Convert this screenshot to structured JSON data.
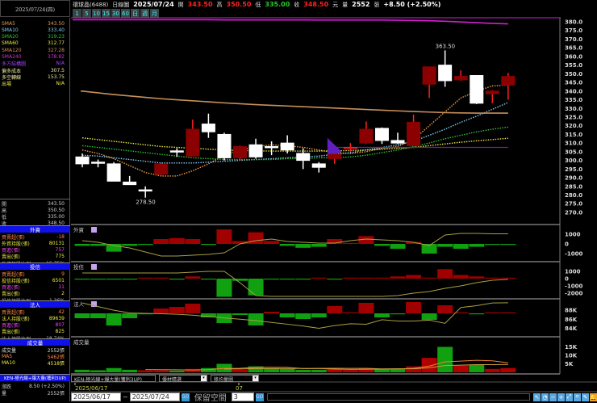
{
  "header": {
    "date_box": "2025/07/24(四)",
    "stock": "環球晶(6488)",
    "chart_type": "日線圖",
    "date": "2025/07/24",
    "open_label": "開",
    "open": "343.50",
    "high_label": "高",
    "high": "350.50",
    "low_label": "低",
    "low": "335.00",
    "close_label": "收",
    "close": "348.50",
    "unit": "元",
    "vol_label": "量",
    "volume": "2552",
    "vol_unit": "張",
    "change": "+8.50 (+2.50%)"
  },
  "periods": [
    "1",
    "5",
    "10",
    "15",
    "30",
    "60",
    "日",
    "週",
    "月"
  ],
  "indicators": [
    {
      "label": "SMA5",
      "value": "343.50",
      "color": "#e0a050",
      "mark": "#2c2"
    },
    {
      "label": "SMA10",
      "value": "333.40",
      "color": "#80c8f0",
      "mark": "#e22"
    },
    {
      "label": "SMA20",
      "value": "319.23",
      "color": "#30c030",
      "mark": "#e22"
    },
    {
      "label": "SMA60",
      "value": "312.77",
      "color": "#e8e840",
      "mark": "#e22"
    },
    {
      "label": "SMA120",
      "value": "327.28",
      "color": "#c8905a",
      "mark": "#e22"
    },
    {
      "label": "SMA240",
      "value": "378.82",
      "color": "#d030d0",
      "mark": "#2c2"
    },
    {
      "label": "多方結構圖",
      "value": "N/A",
      "color": "#a040ff",
      "mark": ""
    },
    {
      "label": "偏多成本",
      "value": "307.5",
      "color": "#e8e8a0",
      "mark": ""
    },
    {
      "label": "多空轉線",
      "value": "153.75",
      "color": "#e8e8a0",
      "mark": ""
    },
    {
      "label": "出場",
      "value": "N/A",
      "color": "#e8e840",
      "mark": ""
    }
  ],
  "ohlc": [
    {
      "label": "開",
      "value": "343.50"
    },
    {
      "label": "高",
      "value": "350.50"
    },
    {
      "label": "低",
      "value": "335.00"
    },
    {
      "label": "收",
      "value": "348.50"
    }
  ],
  "sections": [
    {
      "title": "外資",
      "rows": [
        {
          "label": "買賣超(張)",
          "value": "-18",
          "color": "#f84",
          "mark": "#2c2"
        },
        {
          "label": "外資持股(張)",
          "value": "80131",
          "color": "#ee4",
          "mark": "#2c2"
        },
        {
          "label": "買進(張)",
          "value": "757",
          "color": "#e4e",
          "mark": "#e22"
        },
        {
          "label": "賣出(張)",
          "value": "775",
          "color": "#ee4",
          "mark": "#e22"
        },
        {
          "label": "外資持股比例",
          "value": "16.75%",
          "color": "#bbb",
          "mark": "#2c2"
        }
      ]
    },
    {
      "title": "投信",
      "rows": [
        {
          "label": "買賣超(張)",
          "value": "9",
          "color": "#f84",
          "mark": "#e22"
        },
        {
          "label": "投信持股(張)",
          "value": "6501",
          "color": "#ee4",
          "mark": "#2c2"
        },
        {
          "label": "買進(張)",
          "value": "11",
          "color": "#e4e",
          "mark": "#e22"
        },
        {
          "label": "賣出(張)",
          "value": "2",
          "color": "#ee4",
          "mark": "#e22"
        },
        {
          "label": "投信持股比例",
          "value": "1.36%",
          "color": "#bbb",
          "mark": "#bbb"
        }
      ]
    },
    {
      "title": "法人",
      "rows": [
        {
          "label": "買賣超(張)",
          "value": "42",
          "color": "#f84",
          "mark": "#2c2"
        },
        {
          "label": "法人持股(張)",
          "value": "89639",
          "color": "#ee4",
          "mark": "#e22"
        },
        {
          "label": "買進(張)",
          "value": "807",
          "color": "#e4e",
          "mark": "#e22"
        },
        {
          "label": "賣出(張)",
          "value": "825",
          "color": "#ee4",
          "mark": "#e22"
        },
        {
          "label": "法人持股比例",
          "value": "18.74%",
          "color": "#bbb",
          "mark": "#bbb"
        }
      ]
    },
    {
      "title": "成交量",
      "rows": [
        {
          "label": "成交量",
          "value": "2552張",
          "color": "#ddd",
          "mark": "#e22"
        },
        {
          "label": "MA5",
          "value": "5462張",
          "color": "#f84",
          "mark": "#2c2"
        },
        {
          "label": "MA10",
          "value": "4518張",
          "color": "#ee4",
          "mark": "#e22"
        }
      ]
    }
  ],
  "bottom_left": {
    "title": "KEN-極光線+爆大量(獲利3UP)",
    "rows": [
      {
        "label": "漲跌",
        "value": "8.50 (+2.50%)"
      },
      {
        "label": "量",
        "value": "2552張"
      }
    ]
  },
  "strategy": {
    "label": "KEN-極光線+爆大量(獲利3UP)",
    "select1": "優材精選",
    "select2": "移均量圖"
  },
  "toolbar": {
    "start": "2025/06/17",
    "sep": "~",
    "end": "2025/07/24",
    "go": "GO",
    "reserve_label": "保留空間",
    "reserve_value": "3",
    "go2": "GO",
    "icons": [
      "pointer-icon",
      "clock-icon",
      "minus-icon",
      "plus-icon",
      "zoom-fit-icon",
      "crosshair-icon",
      "pen-icon",
      "bell-icon"
    ]
  },
  "chart_data": {
    "type": "candlestick",
    "x_tick_labels": [
      "2025/06/17",
      "07"
    ],
    "y_ticks": [
      "380.0",
      "375.0",
      "370.0",
      "365.0",
      "360.0",
      "355.0",
      "350.0",
      "345.0",
      "340.0",
      "335.0",
      "330.0",
      "325.0",
      "320.0",
      "315.0",
      "310.0",
      "305.0",
      "300.0",
      "295.0",
      "290.0",
      "285.0",
      "280.0",
      "275.0",
      "270.0"
    ],
    "ylim": [
      270,
      380
    ],
    "up_color": "#8b0000",
    "down_color": "#ffffff",
    "candles": [
      [
        302,
        304,
        296,
        298
      ],
      [
        299,
        300.5,
        296,
        298.5
      ],
      [
        298,
        299,
        288,
        288
      ],
      [
        287.5,
        291,
        286,
        286
      ],
      [
        283,
        285,
        278.5,
        283
      ],
      [
        292,
        298.5,
        291,
        298
      ],
      [
        305.5,
        307,
        302,
        305
      ],
      [
        302.5,
        323.5,
        302.5,
        318
      ],
      [
        321,
        327,
        313,
        316.5
      ],
      [
        315,
        316,
        300,
        301.5
      ],
      [
        301.5,
        308.5,
        300,
        308
      ],
      [
        309,
        312.5,
        301,
        302
      ],
      [
        308,
        311,
        303,
        307.5
      ],
      [
        310,
        314.5,
        304,
        306
      ],
      [
        304,
        307,
        295,
        300
      ],
      [
        298,
        299,
        293,
        296
      ],
      [
        301,
        303.5,
        298,
        303.5
      ],
      [
        307,
        310,
        305,
        307.5
      ],
      [
        310,
        322.5,
        309.5,
        318
      ],
      [
        318.5,
        319,
        309.5,
        311.5
      ],
      [
        311.5,
        316,
        309.5,
        310
      ],
      [
        308.5,
        326.5,
        308.5,
        322
      ],
      [
        344,
        354,
        336,
        354
      ],
      [
        355,
        363.5,
        342.5,
        346
      ],
      [
        346.5,
        352,
        346,
        348.5
      ],
      [
        349,
        349,
        332.5,
        333
      ],
      [
        338.5,
        340.5,
        333,
        340
      ],
      [
        343.5,
        350.5,
        335,
        348.5
      ]
    ],
    "annotations": [
      {
        "text": "363.50",
        "index": 23,
        "value": 363.5
      },
      {
        "text": "278.50",
        "index": 4,
        "value": 278.5
      }
    ],
    "series": [
      {
        "name": "SMA5",
        "color": "#f0a040",
        "style": "dotted",
        "values": [
          306,
          304,
          301,
          297,
          293,
          291,
          291,
          294,
          298,
          303,
          306,
          308,
          309,
          308.5,
          307.5,
          306,
          304.5,
          304,
          305,
          307,
          308,
          312,
          320,
          328,
          336,
          340,
          343,
          343.5
        ]
      },
      {
        "name": "SMA10",
        "color": "#80c8f0",
        "style": "dotted",
        "values": [
          303,
          302.5,
          301.5,
          300.5,
          299.5,
          298.5,
          298.5,
          298.5,
          299,
          299.5,
          300,
          300.5,
          301,
          301.5,
          302,
          302.5,
          303.5,
          304.5,
          306,
          307.5,
          309,
          311,
          314.5,
          318,
          322,
          325.5,
          329.5,
          333.4
        ]
      },
      {
        "name": "SMA20",
        "color": "#30c030",
        "style": "dotted",
        "values": [
          308.5,
          307.5,
          306.5,
          305.5,
          304.5,
          303.5,
          302.5,
          301.5,
          301,
          300.5,
          300.5,
          300.5,
          300.5,
          301,
          301,
          301.5,
          301.5,
          302,
          303,
          304.5,
          306,
          308,
          310,
          312.5,
          314.5,
          316.5,
          318,
          319.23
        ]
      },
      {
        "name": "SMA60",
        "color": "#e8e840",
        "style": "dotted",
        "values": [
          313,
          312,
          311,
          310,
          309,
          308,
          307.5,
          307,
          306.5,
          306,
          305.7,
          305.5,
          305.4,
          305.4,
          305.4,
          305.4,
          305.5,
          305.7,
          306,
          306.5,
          307,
          307.5,
          308.5,
          309.5,
          310.5,
          311.3,
          312,
          312.77
        ]
      },
      {
        "name": "SMA120",
        "color": "#c8905a",
        "style": "solid",
        "values": [
          340,
          339,
          338,
          337.2,
          336.4,
          335.6,
          335,
          334.4,
          333.8,
          333.2,
          332.7,
          332.2,
          331.8,
          331.4,
          331,
          330.6,
          330.2,
          329.8,
          329.4,
          329,
          328.6,
          328.2,
          327.9,
          327.6,
          327.4,
          327.3,
          327.3,
          327.28
        ]
      },
      {
        "name": "SMA240",
        "color": "#d020d0",
        "style": "solid",
        "values": [
          381.2,
          381.2,
          381.2,
          381.2,
          381.2,
          381.2,
          381.2,
          381.2,
          381.2,
          381.1,
          381.1,
          381.1,
          381.1,
          381.1,
          381.1,
          381,
          381,
          381,
          381,
          381,
          380.9,
          380.8,
          380.6,
          380.3,
          379.9,
          379.5,
          379.1,
          378.82
        ]
      }
    ],
    "cost_line": {
      "value": 307.5,
      "from_index": 16,
      "color": "#7020a0"
    },
    "signal_marker": {
      "index": 16,
      "type": "triangle",
      "color": "#6020c0"
    },
    "panels": [
      {
        "title": "外資",
        "ticks": [
          {
            "label": "1000",
            "value": 1000
          },
          {
            "label": "0",
            "value": 0
          },
          {
            "label": "-1000",
            "value": -1000
          }
        ],
        "bars": [
          -200,
          -200,
          -800,
          -200,
          -100,
          500,
          600,
          500,
          -100,
          1500,
          300,
          1200,
          300,
          -200,
          -400,
          -300,
          500,
          100,
          800,
          -200,
          -500,
          200,
          -1000,
          -300,
          -500,
          -300,
          -50,
          -50
        ],
        "line": [
          330,
          170,
          -170,
          -420,
          -830,
          -1250,
          -1250,
          -1170,
          -1080,
          -920,
          0,
          330,
          500,
          250,
          170,
          80,
          80,
          330,
          500,
          420,
          330,
          170,
          -170,
          920,
          1080,
          1080,
          1040,
          1040
        ],
        "line_color": "#a8a040"
      },
      {
        "title": "投信",
        "ticks": [
          {
            "label": "1000",
            "value": 1000
          },
          {
            "label": "0",
            "value": 0
          },
          {
            "label": "-1000",
            "value": -1000
          },
          {
            "label": "-2000",
            "value": -2000
          }
        ],
        "bars": [
          -50,
          -50,
          -50,
          -50,
          0,
          30,
          -50,
          300,
          -50,
          -2500,
          -300,
          -2300,
          -50,
          -50,
          -50,
          30,
          -30,
          30,
          30,
          0,
          300,
          500,
          100,
          1300,
          500,
          300,
          30,
          30
        ],
        "line": [
          780,
          780,
          780,
          780,
          780,
          780,
          780,
          890,
          1000,
          1000,
          -560,
          -2330,
          -2440,
          -2440,
          -2440,
          -2440,
          -2440,
          -2440,
          -2440,
          -2440,
          -2330,
          -2000,
          -1780,
          -1330,
          -1000,
          -560,
          -220,
          -110
        ],
        "line_color": "#a8a040"
      },
      {
        "title": "法人",
        "ticks": [
          {
            "label": "88K",
            "value": 88000
          },
          {
            "label": "86K",
            "value": 86000
          },
          {
            "label": "84K",
            "value": 84000
          }
        ],
        "bars": [
          -600,
          -600,
          -1500,
          -600,
          -100,
          600,
          800,
          1200,
          -500,
          -1200,
          -200,
          -1500,
          200,
          -500,
          -700,
          -500,
          900,
          100,
          1300,
          -500,
          -100,
          1400,
          -800,
          1000,
          100,
          -100,
          100,
          100
        ],
        "line": [
          89600,
          88800,
          88000,
          87400,
          87300,
          87200,
          87100,
          86900,
          86600,
          86300,
          86000,
          85700,
          85300,
          84900,
          84500,
          84000,
          84600,
          85000,
          84900,
          85900,
          85600,
          85600,
          85800,
          85100,
          88600,
          89000,
          89600,
          89639
        ],
        "line_color": "#a8a040"
      },
      {
        "title": "成交量",
        "ticks": [
          {
            "label": "15K",
            "value": 15000
          },
          {
            "label": "10K",
            "value": 10000
          },
          {
            "label": "5K",
            "value": 5000
          }
        ],
        "bars": [
          1500,
          1200,
          2500,
          1500,
          1200,
          1200,
          1000,
          2000,
          2500,
          5000,
          1500,
          3500,
          2500,
          2000,
          1500,
          1500,
          2000,
          1500,
          2500,
          2000,
          2000,
          3500,
          8500,
          15000,
          4000,
          4500,
          2000,
          2552
        ],
        "ma_colors": [
          "#f08030",
          "#c8a040"
        ]
      }
    ]
  }
}
